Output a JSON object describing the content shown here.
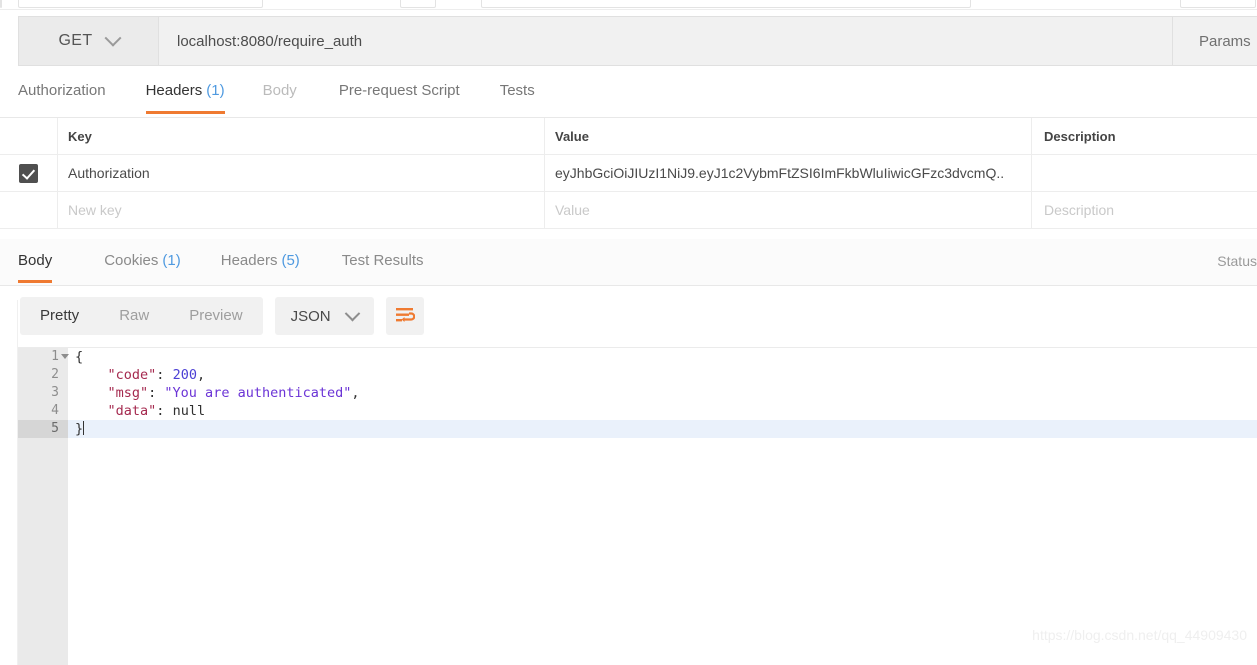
{
  "request": {
    "method": "GET",
    "url": "localhost:8080/require_auth",
    "params_label": "Params",
    "tabs": [
      {
        "label": "Authorization",
        "count": null,
        "state": "normal"
      },
      {
        "label": "Headers",
        "count": "(1)",
        "state": "active"
      },
      {
        "label": "Body",
        "count": null,
        "state": "muted"
      },
      {
        "label": "Pre-request Script",
        "count": null,
        "state": "normal"
      },
      {
        "label": "Tests",
        "count": null,
        "state": "normal"
      }
    ]
  },
  "headers_table": {
    "columns": [
      "Key",
      "Value",
      "Description"
    ],
    "rows": [
      {
        "checked": true,
        "key": "Authorization",
        "value": "eyJhbGciOiJIUzI1NiJ9.eyJ1c2VybmFtZSI6ImFkbWluIiwicGFzc3dvcmQ..",
        "description": ""
      }
    ],
    "new_row": {
      "key_placeholder": "New key",
      "value_placeholder": "Value",
      "description_placeholder": "Description"
    }
  },
  "response": {
    "tabs": [
      {
        "label": "Body",
        "count": null,
        "state": "active"
      },
      {
        "label": "Cookies",
        "count": "(1)",
        "state": "normal"
      },
      {
        "label": "Headers",
        "count": "(5)",
        "state": "normal"
      },
      {
        "label": "Test Results",
        "count": null,
        "state": "normal"
      }
    ],
    "status_label": "Status",
    "view_modes": [
      {
        "label": "Pretty",
        "state": "active"
      },
      {
        "label": "Raw",
        "state": "normal"
      },
      {
        "label": "Preview",
        "state": "normal"
      }
    ],
    "format": "JSON",
    "wrap_icon": "word-wrap-icon",
    "body": {
      "lines": [
        {
          "n": "1",
          "foldable": true,
          "highlight": false,
          "tokens": [
            {
              "t": "punc",
              "v": "{"
            }
          ]
        },
        {
          "n": "2",
          "foldable": false,
          "highlight": false,
          "tokens": [
            {
              "t": "plain",
              "v": "    "
            },
            {
              "t": "key",
              "v": "\"code\""
            },
            {
              "t": "punc",
              "v": ": "
            },
            {
              "t": "num",
              "v": "200"
            },
            {
              "t": "punc",
              "v": ","
            }
          ]
        },
        {
          "n": "3",
          "foldable": false,
          "highlight": false,
          "tokens": [
            {
              "t": "plain",
              "v": "    "
            },
            {
              "t": "key",
              "v": "\"msg\""
            },
            {
              "t": "punc",
              "v": ": "
            },
            {
              "t": "str",
              "v": "\"You are authenticated\""
            },
            {
              "t": "punc",
              "v": ","
            }
          ]
        },
        {
          "n": "4",
          "foldable": false,
          "highlight": false,
          "tokens": [
            {
              "t": "plain",
              "v": "    "
            },
            {
              "t": "key",
              "v": "\"data\""
            },
            {
              "t": "punc",
              "v": ": "
            },
            {
              "t": "null",
              "v": "null"
            }
          ]
        },
        {
          "n": "5",
          "foldable": false,
          "highlight": true,
          "tokens": [
            {
              "t": "punc",
              "v": "}"
            }
          ],
          "caret": true
        }
      ]
    }
  },
  "watermark": "https://blog.csdn.net/qq_44909430",
  "colors": {
    "accent": "#ef7a31",
    "count_blue": "#4f9ae0",
    "json_key": "#a52a4f",
    "json_string": "#6b34d6",
    "json_number": "#4b3fd4",
    "highlight_line": "#eaf1fb"
  }
}
